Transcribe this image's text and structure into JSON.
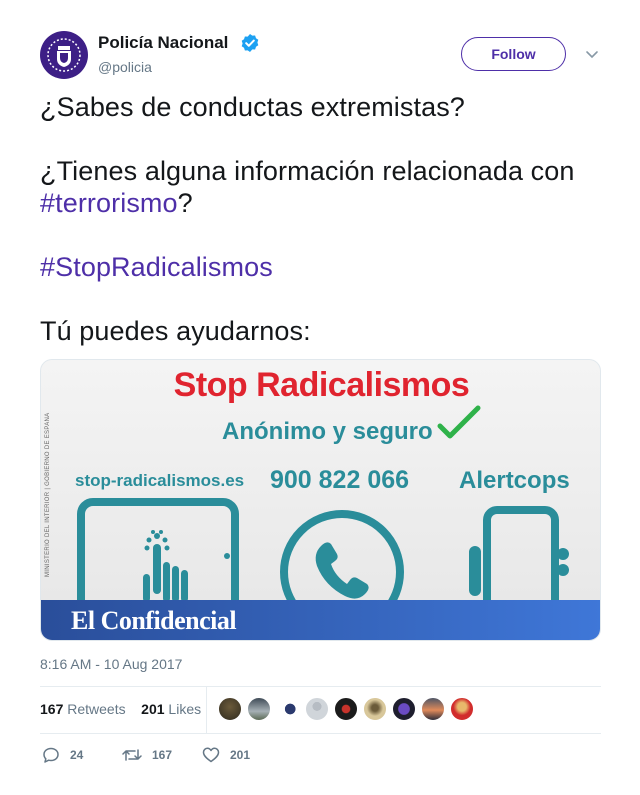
{
  "author": {
    "name": "Policía Nacional",
    "handle": "@policia",
    "verified": true,
    "avatar_icon": "police-badge-icon"
  },
  "follow_label": "Follow",
  "tweet": {
    "line1": "¿Sabes de conductas extremistas?",
    "line2_pre": "¿Tienes alguna información relacionada con",
    "hashtag1": "#terrorismo",
    "line3_post": "?",
    "hashtag2": "#StopRadicalismos",
    "line4": "Tú puedes ayudarnos:"
  },
  "card": {
    "title": "Stop Radicalismos",
    "subtitle": "Anónimo y seguro",
    "ministry": "MINISTERIO DEL INTERIOR | GOBIERNO DE ESPAÑA",
    "items": [
      "stop-radicalismos.es",
      "900 822 066",
      "Alertcops"
    ],
    "source": "El Confidencial"
  },
  "timestamp": "8:16 AM - 10 Aug 2017",
  "stats": {
    "retweets_count": "167",
    "retweets_label": "Retweets",
    "likes_count": "201",
    "likes_label": "Likes"
  },
  "actions": {
    "replies": "24",
    "retweets": "167",
    "likes": "201"
  },
  "colors": {
    "accent": "#4e2fa8",
    "verified": "#1da1f2",
    "card_red": "#e0242f",
    "card_teal": "#2a8d9a",
    "banner": "#2a4e9a"
  }
}
